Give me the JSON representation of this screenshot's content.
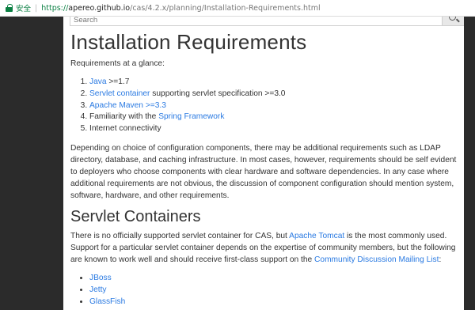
{
  "browser": {
    "secure_label": "安全",
    "separator": "|",
    "url_protocol": "https://",
    "url_host": "apereo.github.io",
    "url_path": "/cas/4.2.x/planning/Installation-Requirements.html"
  },
  "search": {
    "placeholder": "Search"
  },
  "page": {
    "title": "Installation Requirements",
    "intro": "Requirements at a glance:",
    "requirements": {
      "r1_link": "Java",
      "r1_text": " >=1.7",
      "r2_link": "Servlet container",
      "r2_text": " supporting servlet specification >=3.0",
      "r3_link1": "Apache Maven",
      "r3_text1": " ",
      "r3_link2": ">=3.3",
      "r4_text": "Familiarity with the ",
      "r4_link": "Spring Framework",
      "r5_text": "Internet connectivity"
    },
    "paragraph": "Depending on choice of configuration components, there may be additional requirements such as LDAP directory, database, and caching infrastructure. In most cases, however, requirements should be self evident to deployers who choose components with clear hardware and software dependencies. In any case where additional requirements are not obvious, the discussion of component configuration should mention system, software, hardware, and other requirements.",
    "section_title": "Servlet Containers",
    "servlet_p_part1": "There is no officially supported servlet container for CAS, but ",
    "servlet_p_link1": "Apache Tomcat",
    "servlet_p_part2": " is the most commonly used. Support for a particular servlet container depends on the expertise of community members, but the following are known to work well and should receive first-class support on the ",
    "servlet_p_link2": "Community Discussion Mailing List",
    "servlet_p_part3": ":",
    "containers": [
      "JBoss",
      "Jetty",
      "GlassFish"
    ]
  }
}
